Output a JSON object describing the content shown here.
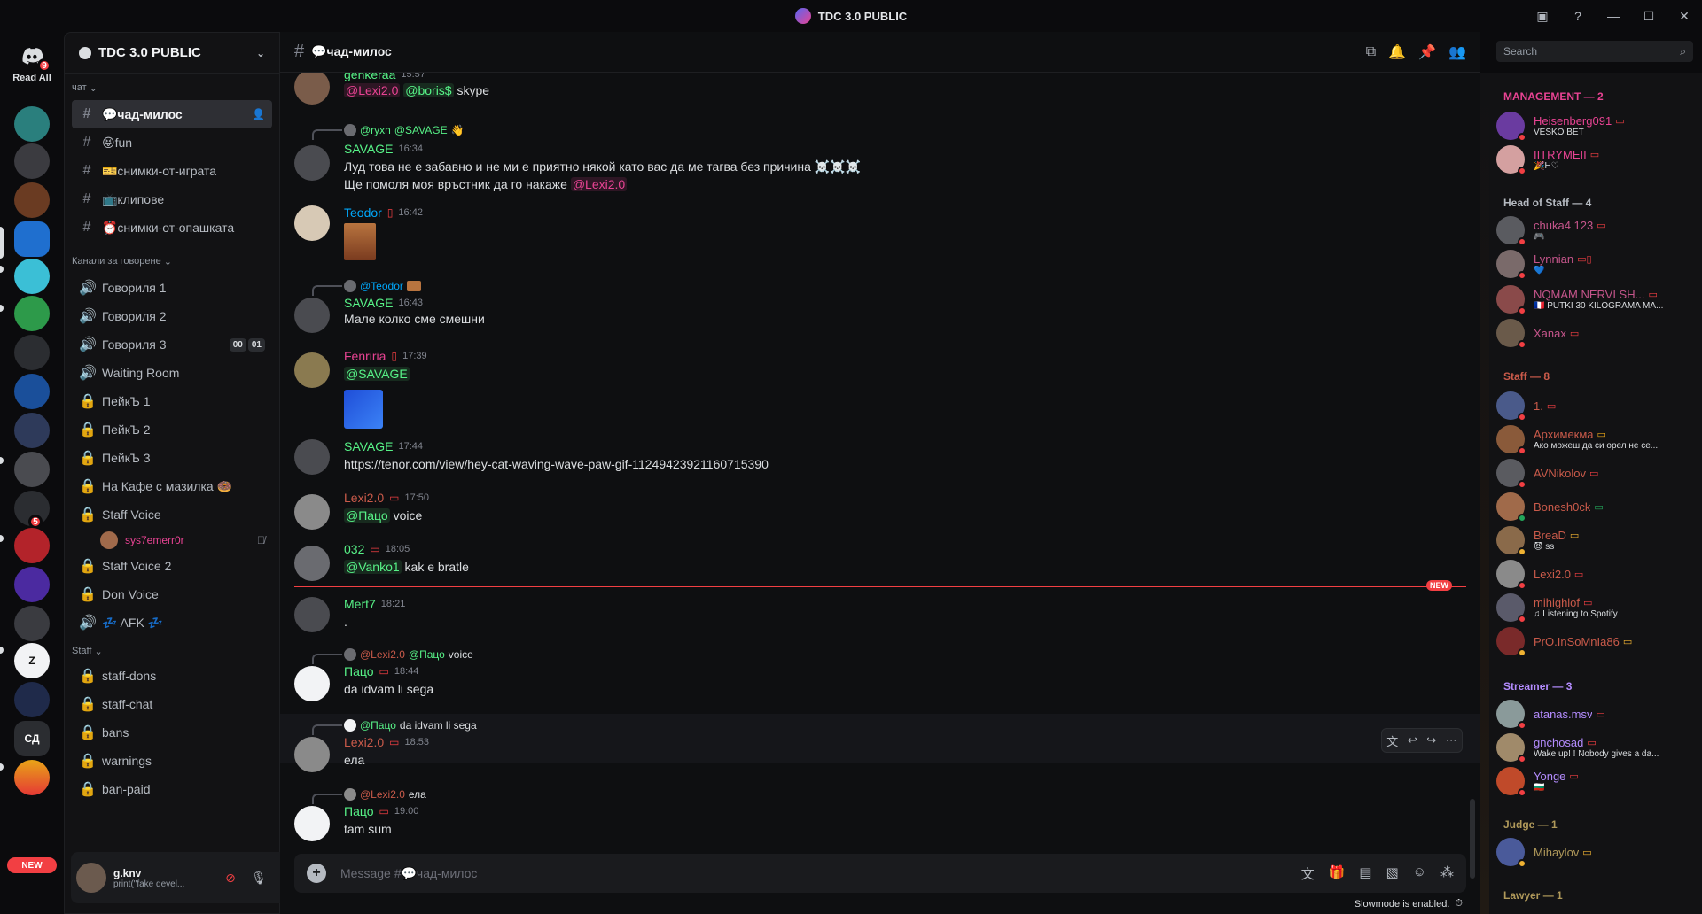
{
  "window": {
    "title": "TDC 3.0 PUBLIC"
  },
  "rail": {
    "read_all": "Read All",
    "home_badge": "9",
    "new_label": "NEW",
    "badges": {
      "b1": "5"
    },
    "text_server": "СД"
  },
  "guild": {
    "name": "TDC 3.0 PUBLIC"
  },
  "categories": {
    "chat": "чат",
    "voice": "Канали за говорене",
    "staff": "Staff"
  },
  "channels": [
    {
      "name": "💬чад-милос",
      "active": true
    },
    {
      "name": "😝fun"
    },
    {
      "name": "🎫снимки-от-играта"
    },
    {
      "name": "📺клипове"
    },
    {
      "name": "⏰снимки-от-опашката"
    }
  ],
  "voice_channels": [
    {
      "name": "Говориля 1"
    },
    {
      "name": "Говориля 2"
    },
    {
      "name": "Говориля 3",
      "badges": [
        "00",
        "01"
      ]
    },
    {
      "name": "Waiting Room"
    },
    {
      "name": "ПейкЪ 1"
    },
    {
      "name": "ПейкЪ 2"
    },
    {
      "name": "ПейкЪ 3"
    },
    {
      "name": "На Кафе с мазилка 🍩"
    },
    {
      "name": "Staff Voice"
    },
    {
      "name": "Staff Voice 2"
    },
    {
      "name": "Don Voice"
    },
    {
      "name": "💤 AFK 💤"
    }
  ],
  "voice_user": "sys7emerr0r",
  "staff_channels": [
    "staff-dons",
    "staff-chat",
    "bans",
    "warnings",
    "ban-paid"
  ],
  "user": {
    "name": "g.knv",
    "status": "print(\"fake devel..."
  },
  "header": {
    "channel": "💬чад-милос"
  },
  "search": {
    "placeholder": "Search"
  },
  "messages": {
    "m0": {
      "author": "genkeraa",
      "time": "15:57",
      "m1": "@Lexi2.0",
      "m2": "@boris$",
      "text": "skype"
    },
    "m1": {
      "reply_user": "@ryxn",
      "reply_mention": "@SAVAGE",
      "reply_emoji": "👋",
      "author": "SAVAGE",
      "time": "16:34",
      "line1": "Луд това не е забавно и не ми е приятно някой като вас да ме тагва без причина ☠️☠️☠️",
      "line2": "Ще помоля моя връстник да го накаже",
      "mention": "@Lexi2.0"
    },
    "m2": {
      "author": "Teodor",
      "time": "16:42"
    },
    "m3": {
      "reply_user": "@Teodor",
      "author": "SAVAGE",
      "time": "16:43",
      "text": "Мале колко сме смешни"
    },
    "m4": {
      "author": "Fenriria",
      "time": "17:39",
      "mention": "@SAVAGE"
    },
    "m5": {
      "author": "SAVAGE",
      "time": "17:44",
      "link": "https://tenor.com/view/hey-cat-waving-wave-paw-gif-11249423921160715390"
    },
    "m6": {
      "author": "Lexi2.0",
      "time": "17:50",
      "mention": "@Пацо",
      "text": "voice"
    },
    "m7": {
      "author": "032",
      "time": "18:05",
      "mention": "@Vanko1",
      "text": "kak e bratle"
    },
    "m8": {
      "author": "Mert7",
      "time": "18:21",
      "text": "."
    },
    "m9": {
      "reply_user": "@Lexi2.0",
      "reply_mention": "@Пацо",
      "reply_text": "voice",
      "author": "Пацо",
      "time": "18:44",
      "text": "da idvam li sega"
    },
    "m10": {
      "reply_user": "@Пацо",
      "reply_text": "da idvam li sega",
      "author": "Lexi2.0",
      "time": "18:53",
      "text": "ела"
    },
    "m11": {
      "reply_user": "@Lexi2.0",
      "reply_text": "ела",
      "author": "Пацо",
      "time": "19:00",
      "text": "tam sum"
    }
  },
  "new_tag": "NEW",
  "composer": {
    "placeholder": "Message #💬чад-милос",
    "slowmode": "Slowmode is enabled."
  },
  "members": {
    "groups": {
      "management": "MANAGEMENT — 2",
      "hos": "Head of Staff — 4",
      "staff": "Staff — 8",
      "streamer": "Streamer — 3",
      "judge": "Judge — 1",
      "lawyer": "Lawyer — 1"
    },
    "list": [
      {
        "name": "Heisenberg091",
        "status": "VESKO BET",
        "color": "#e84393"
      },
      {
        "name": "IITRYMEII",
        "status": "🎉H♡",
        "color": "#e84393"
      },
      {
        "name": "chuka4 123",
        "status": "🎮",
        "color": "#c5558b"
      },
      {
        "name": "Lynnian",
        "status": "💙",
        "color": "#c5558b"
      },
      {
        "name": "NQMAM NERVI SH...",
        "status": "🇫🇷 PUTKI 30 KILOGRAMA MA...",
        "color": "#c5558b"
      },
      {
        "name": "Xanax",
        "status": "",
        "color": "#c5558b"
      },
      {
        "name": "1.",
        "status": "",
        "color": "#c95a4a"
      },
      {
        "name": "Архимекма",
        "status": "Ако можеш да си орел не се...",
        "color": "#c95a4a"
      },
      {
        "name": "AVNikolov",
        "status": "",
        "color": "#c95a4a"
      },
      {
        "name": "Bonesh0ck",
        "status": "",
        "color": "#c95a4a"
      },
      {
        "name": "BreaD",
        "status": "😈 ss",
        "color": "#c95a4a"
      },
      {
        "name": "Lexi2.0",
        "status": "",
        "color": "#c95a4a"
      },
      {
        "name": "mihighlof",
        "status": "♫ Listening to Spotify",
        "color": "#c95a4a"
      },
      {
        "name": "PrO.InSoMnIa86",
        "status": "",
        "color": "#c95a4a"
      },
      {
        "name": "atanas.msv",
        "status": "",
        "color": "#b48cff"
      },
      {
        "name": "gnchosad",
        "status": "Wake up! ! Nobody gives a da...",
        "color": "#b48cff"
      },
      {
        "name": "Yonge",
        "status": "🇧🇬",
        "color": "#b48cff"
      },
      {
        "name": "Mihaylov",
        "status": "",
        "color": "#b0995a"
      }
    ]
  }
}
